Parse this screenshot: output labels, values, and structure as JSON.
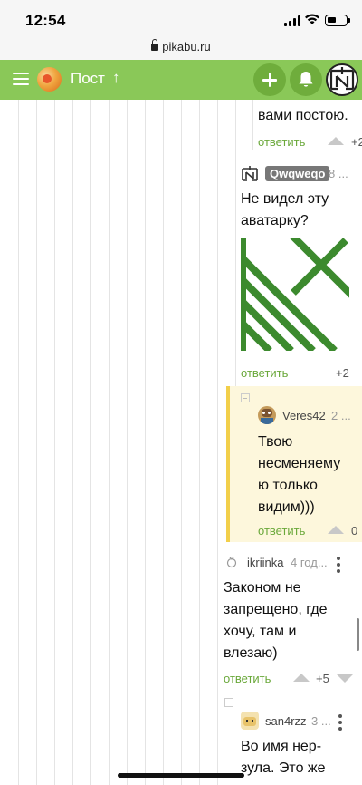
{
  "status": {
    "time": "12:54"
  },
  "browser": {
    "url": "pikabu.ru"
  },
  "header": {
    "title": "Пост",
    "arrow": "↑"
  },
  "comments": [
    {
      "text_line": "вами постою.",
      "reply": "ответить",
      "score": "+2"
    },
    {
      "user": "Qwqweqo",
      "meta": "8 ...",
      "text_lines": [
        "Не видел эту",
        "аватарку?"
      ],
      "reply": "ответить",
      "score": "+2"
    },
    {
      "user": "Veres42",
      "meta": "2 ...",
      "text_lines": [
        "Твою",
        "несменяему",
        "ю только",
        "видим)))"
      ],
      "reply": "ответить",
      "score": "0"
    },
    {
      "user": "ikriinka",
      "meta": "4 год...",
      "text_lines": [
        "Законом не",
        "запрещено, где",
        "хочу, там и",
        "влезаю)"
      ],
      "reply": "ответить",
      "score": "+5"
    },
    {
      "user": "san4rzz",
      "meta": "3 ...",
      "text_lines": [
        "Во имя нер-",
        "зула. Это же"
      ]
    }
  ],
  "colors": {
    "brand_green": "#8ac858",
    "highlight": "#fdf7dc",
    "highlight_border": "#f2cf4a",
    "image_green": "#3c8a2e"
  }
}
